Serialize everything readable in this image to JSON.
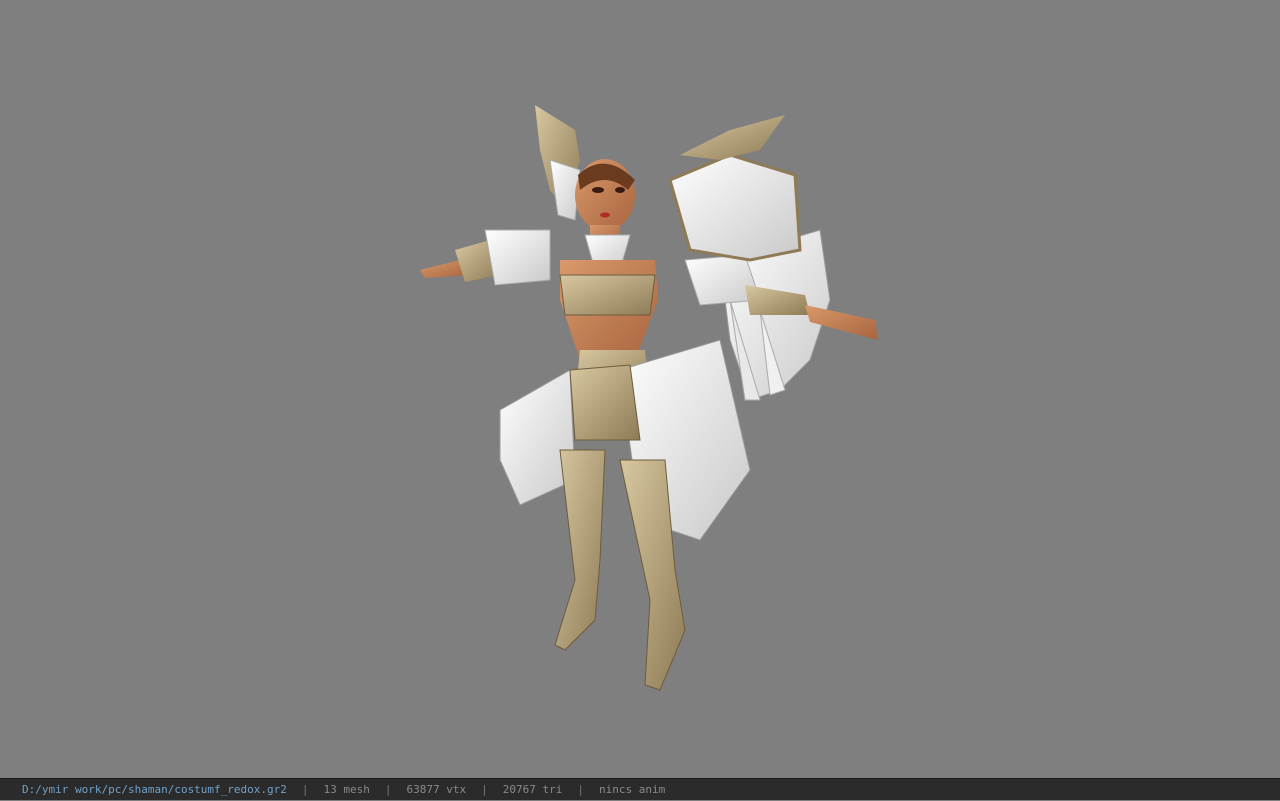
{
  "viewport": {
    "background": "#7f7f7f",
    "model_subject": "3d-character-model"
  },
  "statusbar": {
    "file_path": "D:/ymir work/pc/shaman/costumf_redox.gr2",
    "mesh_count": "13 mesh",
    "vertex_count": "63877 vtx",
    "triangle_count": "20767 tri",
    "anim_status": "nincs anim",
    "separator": "|"
  }
}
